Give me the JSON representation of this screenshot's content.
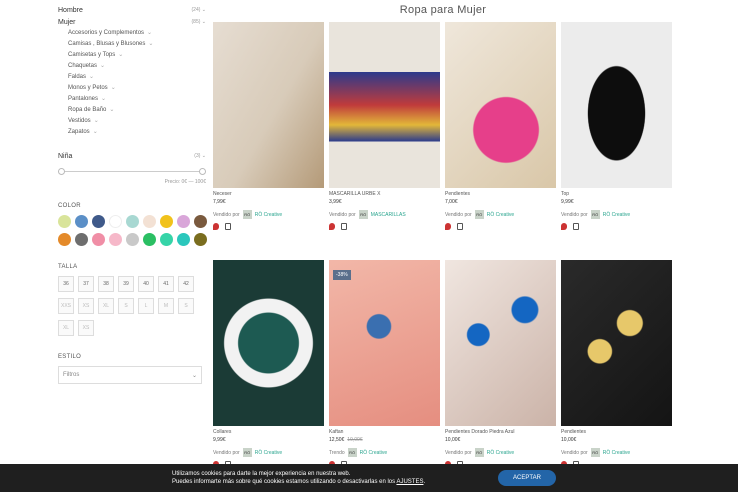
{
  "sidebar": {
    "categories": [
      {
        "label": "Hombre",
        "count": "(24)"
      },
      {
        "label": "Mujer",
        "count": "(85)"
      }
    ],
    "mujer_subcats": [
      "Accesorios y Complementos",
      "Camisas , Blusas y Blusones",
      "Camisetas y Tops",
      "Chaquetas",
      "Faldas",
      "Monos y Petos",
      "Pantalones",
      "Ropa de Baño",
      "Vestidos",
      "Zapatos"
    ],
    "nina": {
      "label": "Niña",
      "count": "(3)"
    },
    "price_label": "Precio: 0€ — 100€",
    "color_title": "COLOR",
    "colors": [
      "#d9e49a",
      "#5b8fc7",
      "#3f5a8a",
      "#ffffff",
      "#a8d8d2",
      "#f3e1d4",
      "#f1c21b",
      "#d9a6d9",
      "#7a5a3e",
      "#e48a2a",
      "#6e6e6e",
      "#f08ea6",
      "#f6b8c9",
      "#c9c9c9",
      "#2bbf63",
      "#36d4a8",
      "#2bc7bc",
      "#7a6d1f"
    ],
    "talla_title": "TALLA",
    "sizes": [
      "36",
      "37",
      "38",
      "39",
      "40",
      "41",
      "42",
      "XXS",
      "XS",
      "XL",
      "S",
      "L",
      "M",
      "S",
      "XL",
      "XS"
    ],
    "estilo_title": "ESTILO",
    "estilo_select": "Filtros"
  },
  "page_title": "Ropa para Mujer",
  "products": [
    {
      "name": "Neceser",
      "price": "7,99€",
      "seller": "RÖ Creative",
      "seller_prefix": "Vendido por"
    },
    {
      "name": "MASCARILLA URBE X",
      "price": "3,99€",
      "seller": "MASCARILLAS",
      "seller_prefix": "Vendido por"
    },
    {
      "name": "Pendientes",
      "price": "7,00€",
      "seller": "RÖ Creative",
      "seller_prefix": "Vendido por"
    },
    {
      "name": "Top",
      "price": "9,99€",
      "seller": "RÖ Creative",
      "seller_prefix": "Vendido por"
    },
    {
      "name": "Collares",
      "price": "9,99€",
      "seller": "RÖ Creative",
      "seller_prefix": "Vendido por"
    },
    {
      "name": "Kaftan",
      "price": "12,50€",
      "old_price": "19,00€",
      "discount": "-38%",
      "seller": "RÖ Creative",
      "seller_prefix": "Trendo"
    },
    {
      "name": "Pendientes Dorado Piedra Azul",
      "price": "10,00€",
      "seller": "RÖ Creative",
      "seller_prefix": "Vendido por"
    },
    {
      "name": "Pendientes",
      "price": "10,00€",
      "seller": "RÖ Creative",
      "seller_prefix": "Vendido por"
    }
  ],
  "seller_logo": "RÖ",
  "cookie": {
    "line1": "Utilizamos cookies para darte la mejor experiencia en nuestra web.",
    "line2": "Puedes informarte más sobre qué cookies estamos utilizando o desactivarlas en los ",
    "link": "AJUSTES",
    "accept": "ACEPTAR"
  }
}
